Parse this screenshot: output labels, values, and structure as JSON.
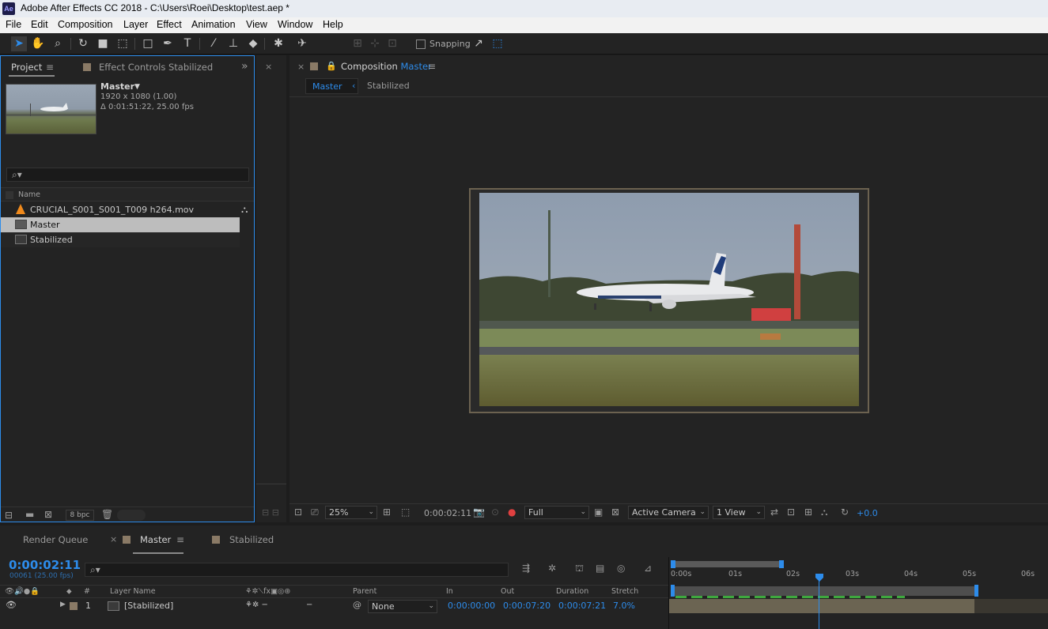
{
  "window": {
    "app_badge": "Ae",
    "title": "Adobe After Effects CC 2018 - C:\\Users\\Roei\\Desktop\\test.aep *"
  },
  "menu": [
    "File",
    "Edit",
    "Composition",
    "Layer",
    "Effect",
    "Animation",
    "View",
    "Window",
    "Help"
  ],
  "toolbar": {
    "snapping_label": "Snapping"
  },
  "project_panel": {
    "tab_project": "Project",
    "tab_effect_controls": "Effect Controls Stabilized",
    "preview": {
      "name": "Master",
      "dimensions": "1920 x 1080 (1.00)",
      "duration": "Δ 0:01:51:22, 25.00 fps"
    },
    "search_icon": "search-icon",
    "name_header": "Name",
    "items": [
      {
        "label": "CRUCIAL_S001_S001_T009 h264.mov",
        "icon": "vlc-cone-icon"
      },
      {
        "label": "Master",
        "icon": "composition-icon"
      },
      {
        "label": "Stabilized",
        "icon": "composition-icon"
      }
    ],
    "bpc": "8 bpc"
  },
  "comp_panel": {
    "tab_prefix": "Composition",
    "tab_name": "Master",
    "flow": [
      "Master",
      "Stabilized"
    ],
    "zoom": "25%",
    "timecode": "0:00:02:11",
    "resolution": "Full",
    "camera": "Active Camera",
    "views": "1 View",
    "exposure": "+0.0"
  },
  "timeline": {
    "tab_render_queue": "Render Queue",
    "tab_master": "Master",
    "tab_stabilized": "Stabilized",
    "current_time": "0:00:02:11",
    "frame_info": "00061 (25.00 fps)",
    "columns": {
      "num": "#",
      "layer_name": "Layer Name",
      "parent": "Parent",
      "in": "In",
      "out": "Out",
      "duration": "Duration",
      "stretch": "Stretch"
    },
    "ruler": [
      "0:00s",
      "01s",
      "02s",
      "03s",
      "04s",
      "05s",
      "06s"
    ],
    "layers": [
      {
        "index": "1",
        "name": "[Stabilized]",
        "parent": "None",
        "in": "0:00:00:00",
        "out": "0:00:07:20",
        "duration": "0:00:07:21",
        "stretch": "7.0%"
      }
    ]
  },
  "colors": {
    "accent_blue": "#2d8ceb",
    "panel_bg": "#232323",
    "label_tan": "#8a7a66",
    "track_green": "#3ea83e"
  }
}
